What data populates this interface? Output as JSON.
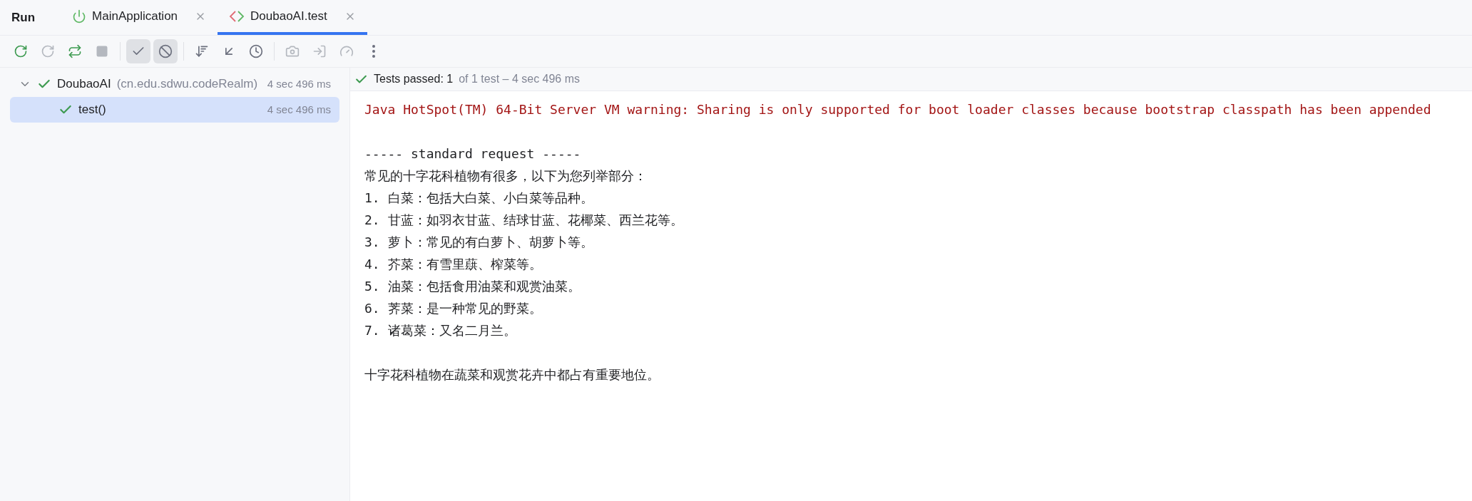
{
  "panel": {
    "title": "Run"
  },
  "tabs": [
    {
      "label": "MainApplication",
      "kind": "app",
      "selected": false
    },
    {
      "label": "DoubaoAI.test",
      "kind": "test",
      "selected": true
    }
  ],
  "toolbar": [
    {
      "kind": "rerun",
      "disabled": false,
      "on": false
    },
    {
      "kind": "rerun-failed",
      "disabled": true,
      "on": false
    },
    {
      "kind": "toggle-auto",
      "disabled": false,
      "on": false
    },
    {
      "kind": "stop",
      "disabled": true,
      "on": false
    },
    {
      "kind": "separator"
    },
    {
      "kind": "show-passed",
      "disabled": false,
      "on": true
    },
    {
      "kind": "show-ignored",
      "disabled": false,
      "on": true
    },
    {
      "kind": "separator"
    },
    {
      "kind": "sort",
      "disabled": false,
      "on": false
    },
    {
      "kind": "collapse",
      "disabled": false,
      "on": false
    },
    {
      "kind": "history",
      "disabled": false,
      "on": false
    },
    {
      "kind": "separator"
    },
    {
      "kind": "camera",
      "disabled": true,
      "on": false
    },
    {
      "kind": "import",
      "disabled": true,
      "on": false
    },
    {
      "kind": "gauge",
      "disabled": true,
      "on": false
    },
    {
      "kind": "more",
      "disabled": false,
      "on": false
    }
  ],
  "tree": [
    {
      "name": "DoubaoAI",
      "detail": "(cn.edu.sdwu.codeRealm)",
      "time": "4 sec 496 ms",
      "passed": true,
      "expanded": true,
      "selected": false,
      "children": [
        {
          "name": "test()",
          "time": "4 sec 496 ms",
          "passed": true,
          "selected": true
        }
      ]
    }
  ],
  "summary": {
    "passed": true,
    "label": "Tests passed: 1",
    "detail": "of 1 test – 4 sec 496 ms"
  },
  "console": [
    {
      "kind": "stderr",
      "text": "Java HotSpot(TM) 64-Bit Server VM warning: Sharing is only supported for boot loader classes because bootstrap classpath has been appended"
    },
    {
      "kind": "blank"
    },
    {
      "kind": "stdout",
      "text": "----- standard request -----"
    },
    {
      "kind": "stdout",
      "text": "常见的十字花科植物有很多，以下为您列举部分："
    },
    {
      "kind": "stdout",
      "text": "1. 白菜：包括大白菜、小白菜等品种。"
    },
    {
      "kind": "stdout",
      "text": "2. 甘蓝：如羽衣甘蓝、结球甘蓝、花椰菜、西兰花等。"
    },
    {
      "kind": "stdout",
      "text": "3. 萝卜：常见的有白萝卜、胡萝卜等。"
    },
    {
      "kind": "stdout",
      "text": "4. 芥菜：有雪里蕻、榨菜等。"
    },
    {
      "kind": "stdout",
      "text": "5. 油菜：包括食用油菜和观赏油菜。"
    },
    {
      "kind": "stdout",
      "text": "6. 荠菜：是一种常见的野菜。"
    },
    {
      "kind": "stdout",
      "text": "7. 诸葛菜：又名二月兰。"
    },
    {
      "kind": "blank"
    },
    {
      "kind": "stdout",
      "text": "十字花科植物在蔬菜和观赏花卉中都占有重要地位。"
    }
  ]
}
